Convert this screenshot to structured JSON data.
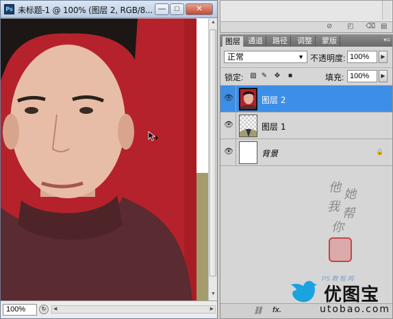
{
  "document": {
    "title": "未标题-1 @ 100% (图层 2, RGB/8...",
    "app_icon": "Ps",
    "buttons": {
      "minimize": "—",
      "maximize": "□",
      "close": "✕"
    },
    "zoom": "100%"
  },
  "layers_panel": {
    "tabs": [
      "图层",
      "通道",
      "路径",
      "调整",
      "蒙版"
    ],
    "active_tab": "图层",
    "blend_mode": "正常",
    "opacity_label": "不透明度:",
    "opacity_value": "100%",
    "lock_label": "锁定:",
    "fill_label": "填充:",
    "fill_value": "100%",
    "layers": [
      {
        "name": "图层 2",
        "selected": true,
        "visible": true
      },
      {
        "name": "图层 1",
        "selected": false,
        "visible": true
      },
      {
        "name": "背景",
        "selected": false,
        "visible": true,
        "locked": true
      }
    ],
    "bottom_icons": [
      "link-icon",
      "fx-icon"
    ]
  },
  "watermark": {
    "chars": [
      "他",
      "她",
      "我",
      "帮",
      "你"
    ],
    "caption": "PS 教 程 网"
  },
  "logo": {
    "main": "优图宝",
    "sub": "utobao.com"
  },
  "colors": {
    "selection": "#3d8ee6",
    "canvas_red": "#b5222b",
    "sweater": "#5a2b30"
  }
}
